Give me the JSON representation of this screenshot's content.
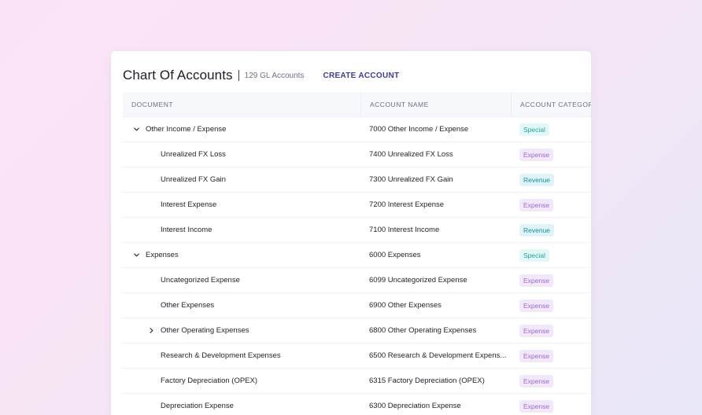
{
  "header": {
    "title": "Chart Of Accounts",
    "subtitle": "129 GL Accounts",
    "create_label": "CREATE ACCOUNT"
  },
  "columns": {
    "document": "DOCUMENT",
    "account_name": "ACCOUNT NAME",
    "account_category": "ACCOUNT CATEGORY"
  },
  "rows": [
    {
      "document": "Other Income / Expense",
      "account_name": "7000 Other Income / Expense",
      "category": "Special",
      "level": 0,
      "chevron": "expanded"
    },
    {
      "document": "Unrealized FX Loss",
      "account_name": "7400 Unrealized FX Loss",
      "category": "Expense",
      "level": 1,
      "chevron": "none"
    },
    {
      "document": "Unrealized FX Gain",
      "account_name": "7300 Unrealized FX Gain",
      "category": "Revenue",
      "level": 1,
      "chevron": "none"
    },
    {
      "document": "Interest Expense",
      "account_name": "7200 Interest Expense",
      "category": "Expense",
      "level": 1,
      "chevron": "none"
    },
    {
      "document": "Interest Income",
      "account_name": "7100 Interest Income",
      "category": "Revenue",
      "level": 1,
      "chevron": "none"
    },
    {
      "document": "Expenses",
      "account_name": "6000 Expenses",
      "category": "Special",
      "level": 0,
      "chevron": "expanded"
    },
    {
      "document": "Uncategorized Expense",
      "account_name": "6099 Uncategorized Expense",
      "category": "Expense",
      "level": 1,
      "chevron": "none"
    },
    {
      "document": "Other Expenses",
      "account_name": "6900 Other Expenses",
      "category": "Expense",
      "level": 1,
      "chevron": "none"
    },
    {
      "document": "Other Operating Expenses",
      "account_name": "6800 Other Operating Expenses",
      "category": "Expense",
      "level": 1,
      "chevron": "collapsed"
    },
    {
      "document": "Research & Development Expenses",
      "account_name": "6500 Research & Development Expens...",
      "category": "Expense",
      "level": 1,
      "chevron": "none"
    },
    {
      "document": "Factory Depreciation (OPEX)",
      "account_name": "6315 Factory Depreciation (OPEX)",
      "category": "Expense",
      "level": 1,
      "chevron": "none"
    },
    {
      "document": "Depreciation Expense",
      "account_name": "6300 Depreciation Expense",
      "category": "Expense",
      "level": 1,
      "chevron": "none"
    }
  ],
  "colors": {
    "accent": "#3b3c9a",
    "special": "#1ca7a0",
    "expense": "#a568cf",
    "revenue": "#1b8fa2"
  },
  "icons": {
    "expanded": "chevron-down-icon",
    "collapsed": "chevron-right-icon"
  }
}
